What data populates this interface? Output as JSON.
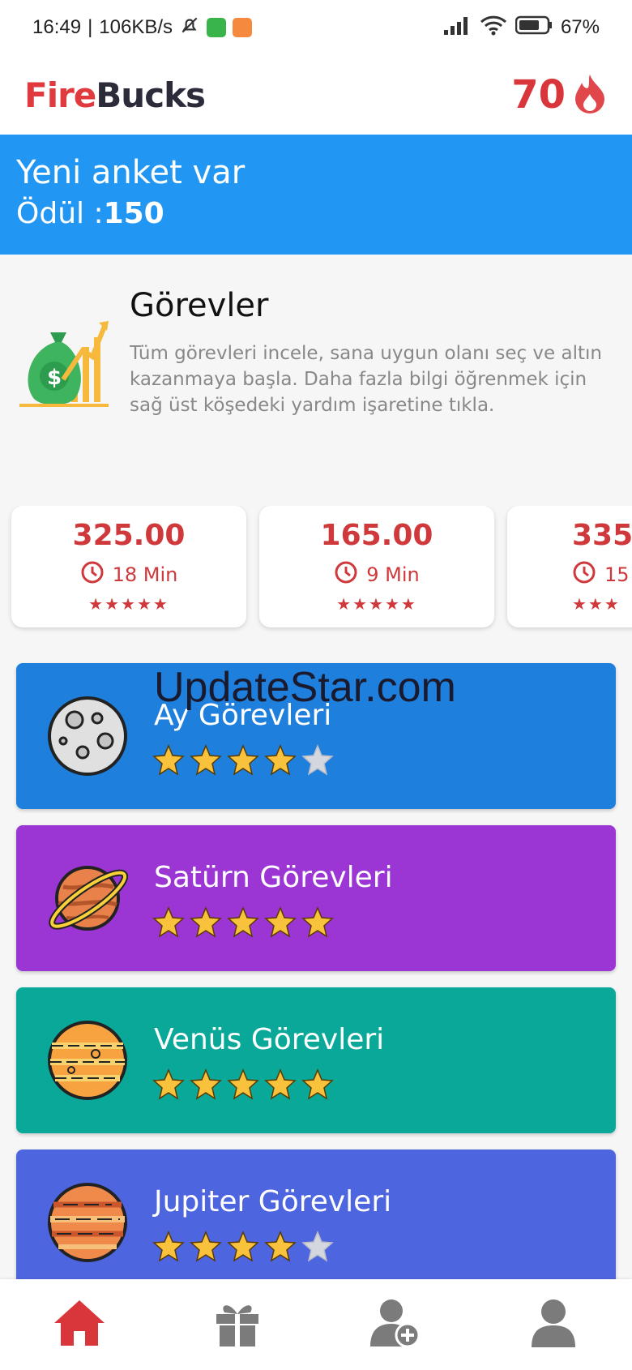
{
  "status_bar": {
    "time": "16:49",
    "speed": "106KB/s",
    "battery": "67%"
  },
  "app": {
    "brand_fire": "Fire",
    "brand_bucks": "Bucks",
    "coin_count": "70",
    "coin_icon": "flame-icon"
  },
  "banner": {
    "line1": "Yeni anket var",
    "reward_label": "Ödül :",
    "reward_value": "150"
  },
  "intro": {
    "title": "Görevler",
    "text": "Tüm görevleri incele, sana uygun olanı seç ve altın kazanmaya başla. Daha fazla bilgi öğrenmek için sağ üst köşedeki yardım işaretine tıkla.",
    "icon": "money-bag-growth-icon"
  },
  "offers": [
    {
      "price": "325.00",
      "time": "18 Min",
      "rating": "★★★★★"
    },
    {
      "price": "165.00",
      "time": "9 Min",
      "rating": "★★★★★"
    },
    {
      "price": "335.",
      "time": "15",
      "rating": "★★★"
    }
  ],
  "categories": [
    {
      "title": "Ay Görevleri",
      "stars": 4,
      "color": "#1e7fdc",
      "planet": "moon-icon"
    },
    {
      "title": "Satürn Görevleri",
      "stars": 5,
      "color": "#9b35d3",
      "planet": "saturn-icon"
    },
    {
      "title": "Venüs Görevleri",
      "stars": 5,
      "color": "#0aa898",
      "planet": "venus-icon"
    },
    {
      "title": "Jupiter Görevleri",
      "stars": 4,
      "color": "#4e65e0",
      "planet": "jupiter-icon"
    }
  ],
  "watermark": "UpdateStar.com",
  "nav": [
    {
      "icon": "home-icon",
      "active": true
    },
    {
      "icon": "gift-icon",
      "active": false
    },
    {
      "icon": "add-user-icon",
      "active": false
    },
    {
      "icon": "profile-icon",
      "active": false
    }
  ],
  "colors": {
    "accent_red": "#d8363a",
    "banner_blue": "#2196f3",
    "star_gold": "#f9c23c",
    "nav_gray": "#7b7b7b"
  }
}
